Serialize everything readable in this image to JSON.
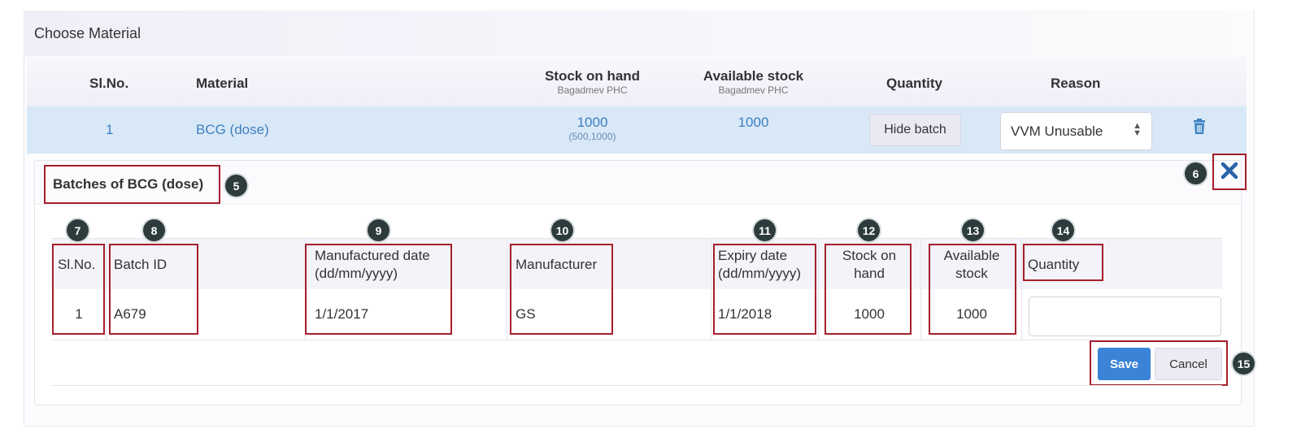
{
  "panel": {
    "title": "Choose Material"
  },
  "main_table": {
    "headers": {
      "slno": "Sl.No.",
      "material": "Material",
      "stock_on_hand": "Stock on hand",
      "stock_on_hand_sub": "Bagadmev PHC",
      "available_stock": "Available stock",
      "available_stock_sub": "Bagadmev PHC",
      "quantity": "Quantity",
      "reason": "Reason"
    },
    "row": {
      "slno": "1",
      "material": "BCG (dose)",
      "stock_on_hand": "1000",
      "stock_on_hand_range": "(500,1000)",
      "available_stock": "1000",
      "hide_batch_label": "Hide batch",
      "reason_selected": "VVM Unusable"
    }
  },
  "batches": {
    "title": "Batches of BCG (dose)",
    "headers": {
      "slno": "Sl.No.",
      "batch_id": "Batch ID",
      "mfg_date_l1": "Manufactured date",
      "mfg_date_l2": "(dd/mm/yyyy)",
      "manufacturer": "Manufacturer",
      "expiry_l1": "Expiry date",
      "expiry_l2": "(dd/mm/yyyy)",
      "stock_l1": "Stock on",
      "stock_l2": "hand",
      "avail_l1": "Available",
      "avail_l2": "stock",
      "quantity": "Quantity"
    },
    "rows": [
      {
        "slno": "1",
        "batch_id": "A679",
        "mfg_date": "1/1/2017",
        "manufacturer": "GS",
        "expiry": "1/1/2018",
        "stock": "1000",
        "available": "1000",
        "quantity": ""
      }
    ],
    "save_label": "Save",
    "cancel_label": "Cancel"
  },
  "callouts": {
    "c5": "5",
    "c6": "6",
    "c7": "7",
    "c8": "8",
    "c9": "9",
    "c10": "10",
    "c11": "11",
    "c12": "12",
    "c13": "13",
    "c14": "14",
    "c15": "15"
  },
  "colors": {
    "accent": "#3a83d6",
    "link": "#3d7fc1",
    "highlight_row": "#d8e8f7",
    "callout_box": "#a51f2b",
    "callout_badge": "#2d3b3d"
  },
  "icons": {
    "trash": "trash-icon",
    "close": "close-icon",
    "select_arrows": "sort-arrows-icon"
  }
}
